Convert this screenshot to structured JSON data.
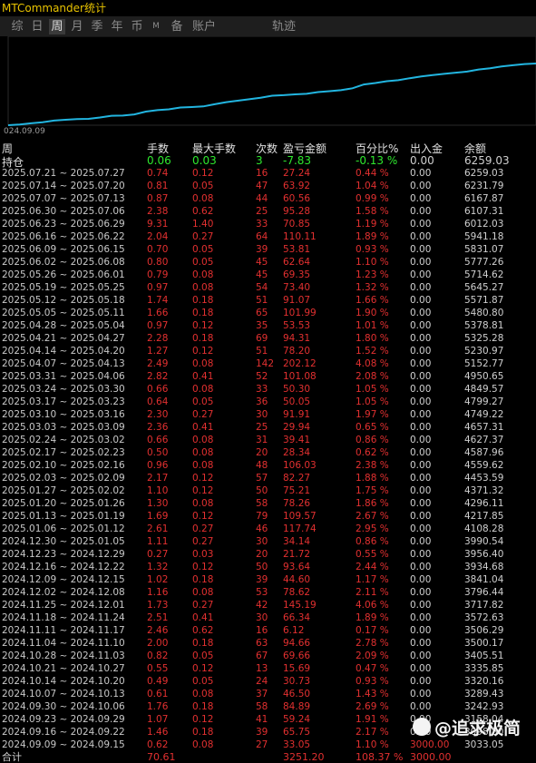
{
  "app": {
    "title": "MTCommander统计"
  },
  "tabs": [
    {
      "label": "综",
      "active": false,
      "small": false
    },
    {
      "label": "日",
      "active": false,
      "small": false
    },
    {
      "label": "周",
      "active": true,
      "small": false
    },
    {
      "label": "月",
      "active": false,
      "small": false
    },
    {
      "label": "季",
      "active": false,
      "small": false
    },
    {
      "label": "年",
      "active": false,
      "small": false
    },
    {
      "label": "币",
      "active": false,
      "small": false
    },
    {
      "label": "M",
      "active": false,
      "small": true
    },
    {
      "label": "备",
      "active": false,
      "small": false
    },
    {
      "label": "账户",
      "active": false,
      "small": false
    },
    {
      "label": "轨迹",
      "active": false,
      "small": false
    }
  ],
  "chart": {
    "start_date_label": "024.09.09",
    "line_color": "#22b5e0"
  },
  "columns": [
    "周",
    "手数",
    "最大手数",
    "次数",
    "盈亏金额",
    "百分比%",
    "出入金",
    "余额"
  ],
  "holding": {
    "label": "持仓",
    "lots": "0.06",
    "max_lots": "0.03",
    "count": "3",
    "pnl": "-7.83",
    "pct": "-0.13 %",
    "inout": "0.00",
    "balance": "6259.03"
  },
  "rows": [
    [
      "2025.07.21 ~ 2025.07.27",
      "0.74",
      "0.12",
      "16",
      "27.24",
      "0.44 %",
      "0.00",
      "6259.03"
    ],
    [
      "2025.07.14 ~ 2025.07.20",
      "0.81",
      "0.05",
      "47",
      "63.92",
      "1.04 %",
      "0.00",
      "6231.79"
    ],
    [
      "2025.07.07 ~ 2025.07.13",
      "0.87",
      "0.08",
      "44",
      "60.56",
      "0.99 %",
      "0.00",
      "6167.87"
    ],
    [
      "2025.06.30 ~ 2025.07.06",
      "2.38",
      "0.62",
      "25",
      "95.28",
      "1.58 %",
      "0.00",
      "6107.31"
    ],
    [
      "2025.06.23 ~ 2025.06.29",
      "9.31",
      "1.40",
      "33",
      "70.85",
      "1.19 %",
      "0.00",
      "6012.03"
    ],
    [
      "2025.06.16 ~ 2025.06.22",
      "2.04",
      "0.27",
      "64",
      "110.11",
      "1.89 %",
      "0.00",
      "5941.18"
    ],
    [
      "2025.06.09 ~ 2025.06.15",
      "0.70",
      "0.05",
      "39",
      "53.81",
      "0.93 %",
      "0.00",
      "5831.07"
    ],
    [
      "2025.06.02 ~ 2025.06.08",
      "0.80",
      "0.05",
      "45",
      "62.64",
      "1.10 %",
      "0.00",
      "5777.26"
    ],
    [
      "2025.05.26 ~ 2025.06.01",
      "0.79",
      "0.08",
      "45",
      "69.35",
      "1.23 %",
      "0.00",
      "5714.62"
    ],
    [
      "2025.05.19 ~ 2025.05.25",
      "0.97",
      "0.08",
      "54",
      "73.40",
      "1.32 %",
      "0.00",
      "5645.27"
    ],
    [
      "2025.05.12 ~ 2025.05.18",
      "1.74",
      "0.18",
      "51",
      "91.07",
      "1.66 %",
      "0.00",
      "5571.87"
    ],
    [
      "2025.05.05 ~ 2025.05.11",
      "1.66",
      "0.18",
      "65",
      "101.99",
      "1.90 %",
      "0.00",
      "5480.80"
    ],
    [
      "2025.04.28 ~ 2025.05.04",
      "0.97",
      "0.12",
      "35",
      "53.53",
      "1.01 %",
      "0.00",
      "5378.81"
    ],
    [
      "2025.04.21 ~ 2025.04.27",
      "2.28",
      "0.18",
      "69",
      "94.31",
      "1.80 %",
      "0.00",
      "5325.28"
    ],
    [
      "2025.04.14 ~ 2025.04.20",
      "1.27",
      "0.12",
      "51",
      "78.20",
      "1.52 %",
      "0.00",
      "5230.97"
    ],
    [
      "2025.04.07 ~ 2025.04.13",
      "2.49",
      "0.08",
      "142",
      "202.12",
      "4.08 %",
      "0.00",
      "5152.77"
    ],
    [
      "2025.03.31 ~ 2025.04.06",
      "2.82",
      "0.41",
      "52",
      "101.08",
      "2.08 %",
      "0.00",
      "4950.65"
    ],
    [
      "2025.03.24 ~ 2025.03.30",
      "0.66",
      "0.08",
      "33",
      "50.30",
      "1.05 %",
      "0.00",
      "4849.57"
    ],
    [
      "2025.03.17 ~ 2025.03.23",
      "0.64",
      "0.05",
      "36",
      "50.05",
      "1.05 %",
      "0.00",
      "4799.27"
    ],
    [
      "2025.03.10 ~ 2025.03.16",
      "2.30",
      "0.27",
      "30",
      "91.91",
      "1.97 %",
      "0.00",
      "4749.22"
    ],
    [
      "2025.03.03 ~ 2025.03.09",
      "2.36",
      "0.41",
      "25",
      "29.94",
      "0.65 %",
      "0.00",
      "4657.31"
    ],
    [
      "2025.02.24 ~ 2025.03.02",
      "0.66",
      "0.08",
      "31",
      "39.41",
      "0.86 %",
      "0.00",
      "4627.37"
    ],
    [
      "2025.02.17 ~ 2025.02.23",
      "0.50",
      "0.08",
      "20",
      "28.34",
      "0.62 %",
      "0.00",
      "4587.96"
    ],
    [
      "2025.02.10 ~ 2025.02.16",
      "0.96",
      "0.08",
      "48",
      "106.03",
      "2.38 %",
      "0.00",
      "4559.62"
    ],
    [
      "2025.02.03 ~ 2025.02.09",
      "2.17",
      "0.12",
      "57",
      "82.27",
      "1.88 %",
      "0.00",
      "4453.59"
    ],
    [
      "2025.01.27 ~ 2025.02.02",
      "1.10",
      "0.12",
      "50",
      "75.21",
      "1.75 %",
      "0.00",
      "4371.32"
    ],
    [
      "2025.01.20 ~ 2025.01.26",
      "1.30",
      "0.08",
      "58",
      "78.26",
      "1.86 %",
      "0.00",
      "4296.11"
    ],
    [
      "2025.01.13 ~ 2025.01.19",
      "1.69",
      "0.12",
      "79",
      "109.57",
      "2.67 %",
      "0.00",
      "4217.85"
    ],
    [
      "2025.01.06 ~ 2025.01.12",
      "2.61",
      "0.27",
      "46",
      "117.74",
      "2.95 %",
      "0.00",
      "4108.28"
    ],
    [
      "2024.12.30 ~ 2025.01.05",
      "1.11",
      "0.27",
      "30",
      "34.14",
      "0.86 %",
      "0.00",
      "3990.54"
    ],
    [
      "2024.12.23 ~ 2024.12.29",
      "0.27",
      "0.03",
      "20",
      "21.72",
      "0.55 %",
      "0.00",
      "3956.40"
    ],
    [
      "2024.12.16 ~ 2024.12.22",
      "1.32",
      "0.12",
      "50",
      "93.64",
      "2.44 %",
      "0.00",
      "3934.68"
    ],
    [
      "2024.12.09 ~ 2024.12.15",
      "1.02",
      "0.18",
      "39",
      "44.60",
      "1.17 %",
      "0.00",
      "3841.04"
    ],
    [
      "2024.12.02 ~ 2024.12.08",
      "1.16",
      "0.08",
      "53",
      "78.62",
      "2.11 %",
      "0.00",
      "3796.44"
    ],
    [
      "2024.11.25 ~ 2024.12.01",
      "1.73",
      "0.27",
      "42",
      "145.19",
      "4.06 %",
      "0.00",
      "3717.82"
    ],
    [
      "2024.11.18 ~ 2024.11.24",
      "2.51",
      "0.41",
      "30",
      "66.34",
      "1.89 %",
      "0.00",
      "3572.63"
    ],
    [
      "2024.11.11 ~ 2024.11.17",
      "2.46",
      "0.62",
      "16",
      "6.12",
      "0.17 %",
      "0.00",
      "3506.29"
    ],
    [
      "2024.11.04 ~ 2024.11.10",
      "2.00",
      "0.18",
      "63",
      "94.66",
      "2.78 %",
      "0.00",
      "3500.17"
    ],
    [
      "2024.10.28 ~ 2024.11.03",
      "0.82",
      "0.05",
      "67",
      "69.66",
      "2.09 %",
      "0.00",
      "3405.51"
    ],
    [
      "2024.10.21 ~ 2024.10.27",
      "0.55",
      "0.12",
      "13",
      "15.69",
      "0.47 %",
      "0.00",
      "3335.85"
    ],
    [
      "2024.10.14 ~ 2024.10.20",
      "0.49",
      "0.05",
      "24",
      "30.73",
      "0.93 %",
      "0.00",
      "3320.16"
    ],
    [
      "2024.10.07 ~ 2024.10.13",
      "0.61",
      "0.08",
      "37",
      "46.50",
      "1.43 %",
      "0.00",
      "3289.43"
    ],
    [
      "2024.09.30 ~ 2024.10.06",
      "1.76",
      "0.18",
      "58",
      "84.89",
      "2.69 %",
      "0.00",
      "3242.93"
    ],
    [
      "2024.09.23 ~ 2024.09.29",
      "1.07",
      "0.12",
      "41",
      "59.24",
      "1.91 %",
      "0.00",
      "3158.04"
    ],
    [
      "2024.09.16 ~ 2024.09.22",
      "1.46",
      "0.18",
      "39",
      "65.75",
      "2.17 %",
      "0.00",
      "3098.80"
    ],
    [
      "2024.09.09 ~ 2024.09.15",
      "0.62",
      "0.08",
      "27",
      "33.05",
      "1.10 %",
      "3000.00",
      "3033.05"
    ]
  ],
  "total": {
    "label": "合计",
    "lots": "70.61",
    "pnl": "3251.20",
    "pct": "108.37 %",
    "inout": "3000.00"
  },
  "watermark": {
    "text": "@追求极简"
  },
  "colors": {
    "green": "#2ee82e",
    "red": "#e23030",
    "accent_title": "#e8c300"
  }
}
